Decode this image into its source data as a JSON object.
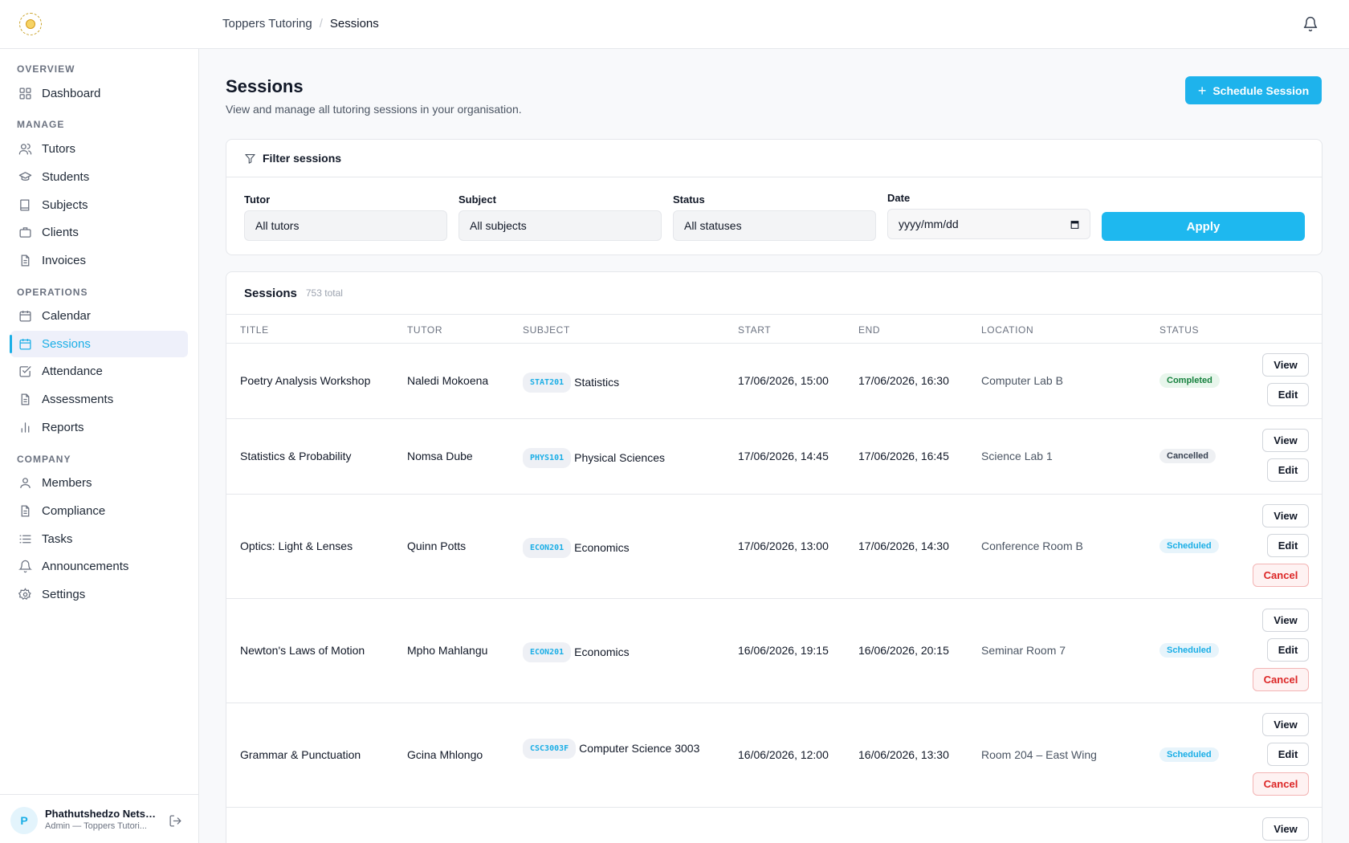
{
  "header": {
    "breadcrumb": [
      "Toppers Tutoring",
      "Sessions"
    ],
    "breadcrumb_sep": "/"
  },
  "sidebar": {
    "sections": [
      {
        "title": "OVERVIEW",
        "items": [
          {
            "label": "Dashboard",
            "icon": "grid-icon"
          }
        ]
      },
      {
        "title": "MANAGE",
        "items": [
          {
            "label": "Tutors",
            "icon": "users-icon"
          },
          {
            "label": "Students",
            "icon": "graduation-cap-icon"
          },
          {
            "label": "Subjects",
            "icon": "book-icon"
          },
          {
            "label": "Clients",
            "icon": "briefcase-icon"
          },
          {
            "label": "Invoices",
            "icon": "file-icon"
          }
        ]
      },
      {
        "title": "OPERATIONS",
        "items": [
          {
            "label": "Calendar",
            "icon": "calendar-icon"
          },
          {
            "label": "Sessions",
            "icon": "calendar-icon",
            "active": true
          },
          {
            "label": "Attendance",
            "icon": "check-square-icon"
          },
          {
            "label": "Assessments",
            "icon": "file-icon"
          },
          {
            "label": "Reports",
            "icon": "bar-chart-icon"
          }
        ]
      },
      {
        "title": "COMPANY",
        "items": [
          {
            "label": "Members",
            "icon": "user-icon"
          },
          {
            "label": "Compliance",
            "icon": "file-icon"
          },
          {
            "label": "Tasks",
            "icon": "list-icon"
          },
          {
            "label": "Announcements",
            "icon": "bell-icon"
          },
          {
            "label": "Settings",
            "icon": "gear-icon"
          }
        ]
      }
    ],
    "user": {
      "initial": "P",
      "name": "Phathutshedzo Netsh...",
      "role": "Admin — Toppers Tutori..."
    }
  },
  "main": {
    "title": "Sessions",
    "subtitle": "View and manage all tutoring sessions in your organisation.",
    "schedule_button": "Schedule Session",
    "filter": {
      "heading": "Filter sessions",
      "tutor_label": "Tutor",
      "tutor_value": "All tutors",
      "subject_label": "Subject",
      "subject_value": "All subjects",
      "status_label": "Status",
      "status_value": "All statuses",
      "date_label": "Date",
      "date_placeholder": "yyyy/mm/dd",
      "apply": "Apply"
    },
    "table": {
      "title": "Sessions",
      "count": "753 total",
      "columns": [
        "TITLE",
        "TUTOR",
        "SUBJECT",
        "START",
        "END",
        "LOCATION",
        "STATUS"
      ],
      "actions": {
        "view": "View",
        "edit": "Edit",
        "cancel": "Cancel"
      },
      "rows": [
        {
          "title": "Poetry Analysis Workshop",
          "tutor": "Naledi Mokoena",
          "code": "STAT201",
          "subject": "Statistics",
          "start": "17/06/2026, 15:00",
          "end": "17/06/2026, 16:30",
          "location": "Computer Lab B",
          "status": "Completed"
        },
        {
          "title": "Statistics & Probability",
          "tutor": "Nomsa Dube",
          "code": "PHYS101",
          "subject": "Physical Sciences",
          "start": "17/06/2026, 14:45",
          "end": "17/06/2026, 16:45",
          "location": "Science Lab 1",
          "status": "Cancelled"
        },
        {
          "title": "Optics: Light & Lenses",
          "tutor": "Quinn Potts",
          "code": "ECON201",
          "subject": "Economics",
          "start": "17/06/2026, 13:00",
          "end": "17/06/2026, 14:30",
          "location": "Conference Room B",
          "status": "Scheduled"
        },
        {
          "title": "Newton's Laws of Motion",
          "tutor": "Mpho Mahlangu",
          "code": "ECON201",
          "subject": "Economics",
          "start": "16/06/2026, 19:15",
          "end": "16/06/2026, 20:15",
          "location": "Seminar Room 7",
          "status": "Scheduled"
        },
        {
          "title": "Grammar & Punctuation",
          "tutor": "Gcina Mhlongo",
          "code": "CSC3003F",
          "subject": "Computer Science 3003",
          "start": "16/06/2026, 12:00",
          "end": "16/06/2026, 13:30",
          "location": "Room 204 – East Wing",
          "status": "Scheduled"
        }
      ]
    }
  }
}
